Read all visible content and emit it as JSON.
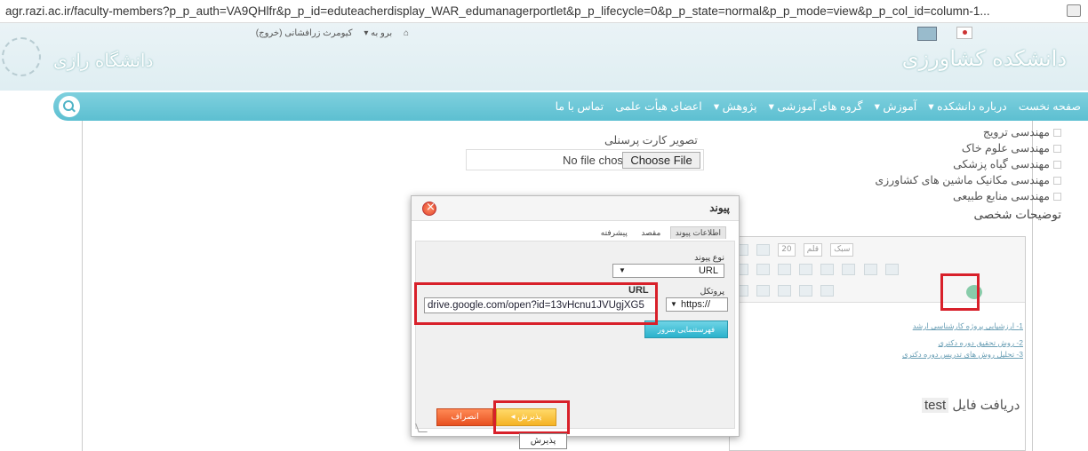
{
  "browser": {
    "url": "agr.razi.ac.ir/faculty-members?p_p_auth=VA9QHlfr&p_p_id=eduteacherdisplay_WAR_edumanagerportlet&p_p_lifecycle=0&p_p_state=normal&p_p_mode=view&p_p_col_id=column-1..."
  },
  "header": {
    "top_links": [
      "برو به ▾",
      "کیومرث زرافشانی (خروج)"
    ],
    "logo_left": "دانشگاه رازی",
    "logo_right": "دانشکده کشاورزی"
  },
  "nav": {
    "items": [
      "صفحه نخست",
      "درباره دانشکده ▾",
      "آموزش ▾",
      "گروه های آموزشی ▾",
      "پژوهش ▾",
      "اعضای هیأت علمی",
      "تماس با ما"
    ]
  },
  "form": {
    "departments": [
      "مهندسی ترویج",
      "مهندسی علوم خاک",
      "مهندسی گیاه پزشکی",
      "مهندسی مکانیک ماشین های کشاورزی",
      "مهندسی منابع طبیعی"
    ],
    "personal_desc_label": "توضیحات شخصی",
    "photo_label": "تصویر کارت پرسنلی",
    "no_file": "No file chosen",
    "choose_file": "Choose File"
  },
  "editor": {
    "toolbar": {
      "style_dd": "سبک",
      "font_dd": "قلم",
      "size_dd": "20"
    },
    "lines": [
      "1- ارزشیابی پروژه کارشناسی ارشد",
      "2- روش تحقیق دوره دکتری",
      "3- تحلیل روش های تدریس دوره دکتری"
    ],
    "download_text": "دریافت فایل",
    "download_word": "test"
  },
  "dialog": {
    "title": "پیوند",
    "tabs": [
      "اطلاعات پیوند",
      "مقصد",
      "پیشرفته"
    ],
    "link_type_label": "نوع پیوند",
    "link_type_value": "URL",
    "protocol_label": "پروتکل",
    "protocol_value": "https://",
    "url_label": "URL",
    "url_value": "drive.google.com/open?id=13vHcnu1JVUgjXG5",
    "browse_server": "فهرستنمایی سرور",
    "ok": "پذیرش ◂",
    "cancel": "انصراف",
    "tooltip": "پذیرش"
  },
  "colors": {
    "nav": "#5cbfd1",
    "annotation": "#d8202a",
    "ok_button": "#f5b324",
    "cancel_button": "#e8501f"
  }
}
